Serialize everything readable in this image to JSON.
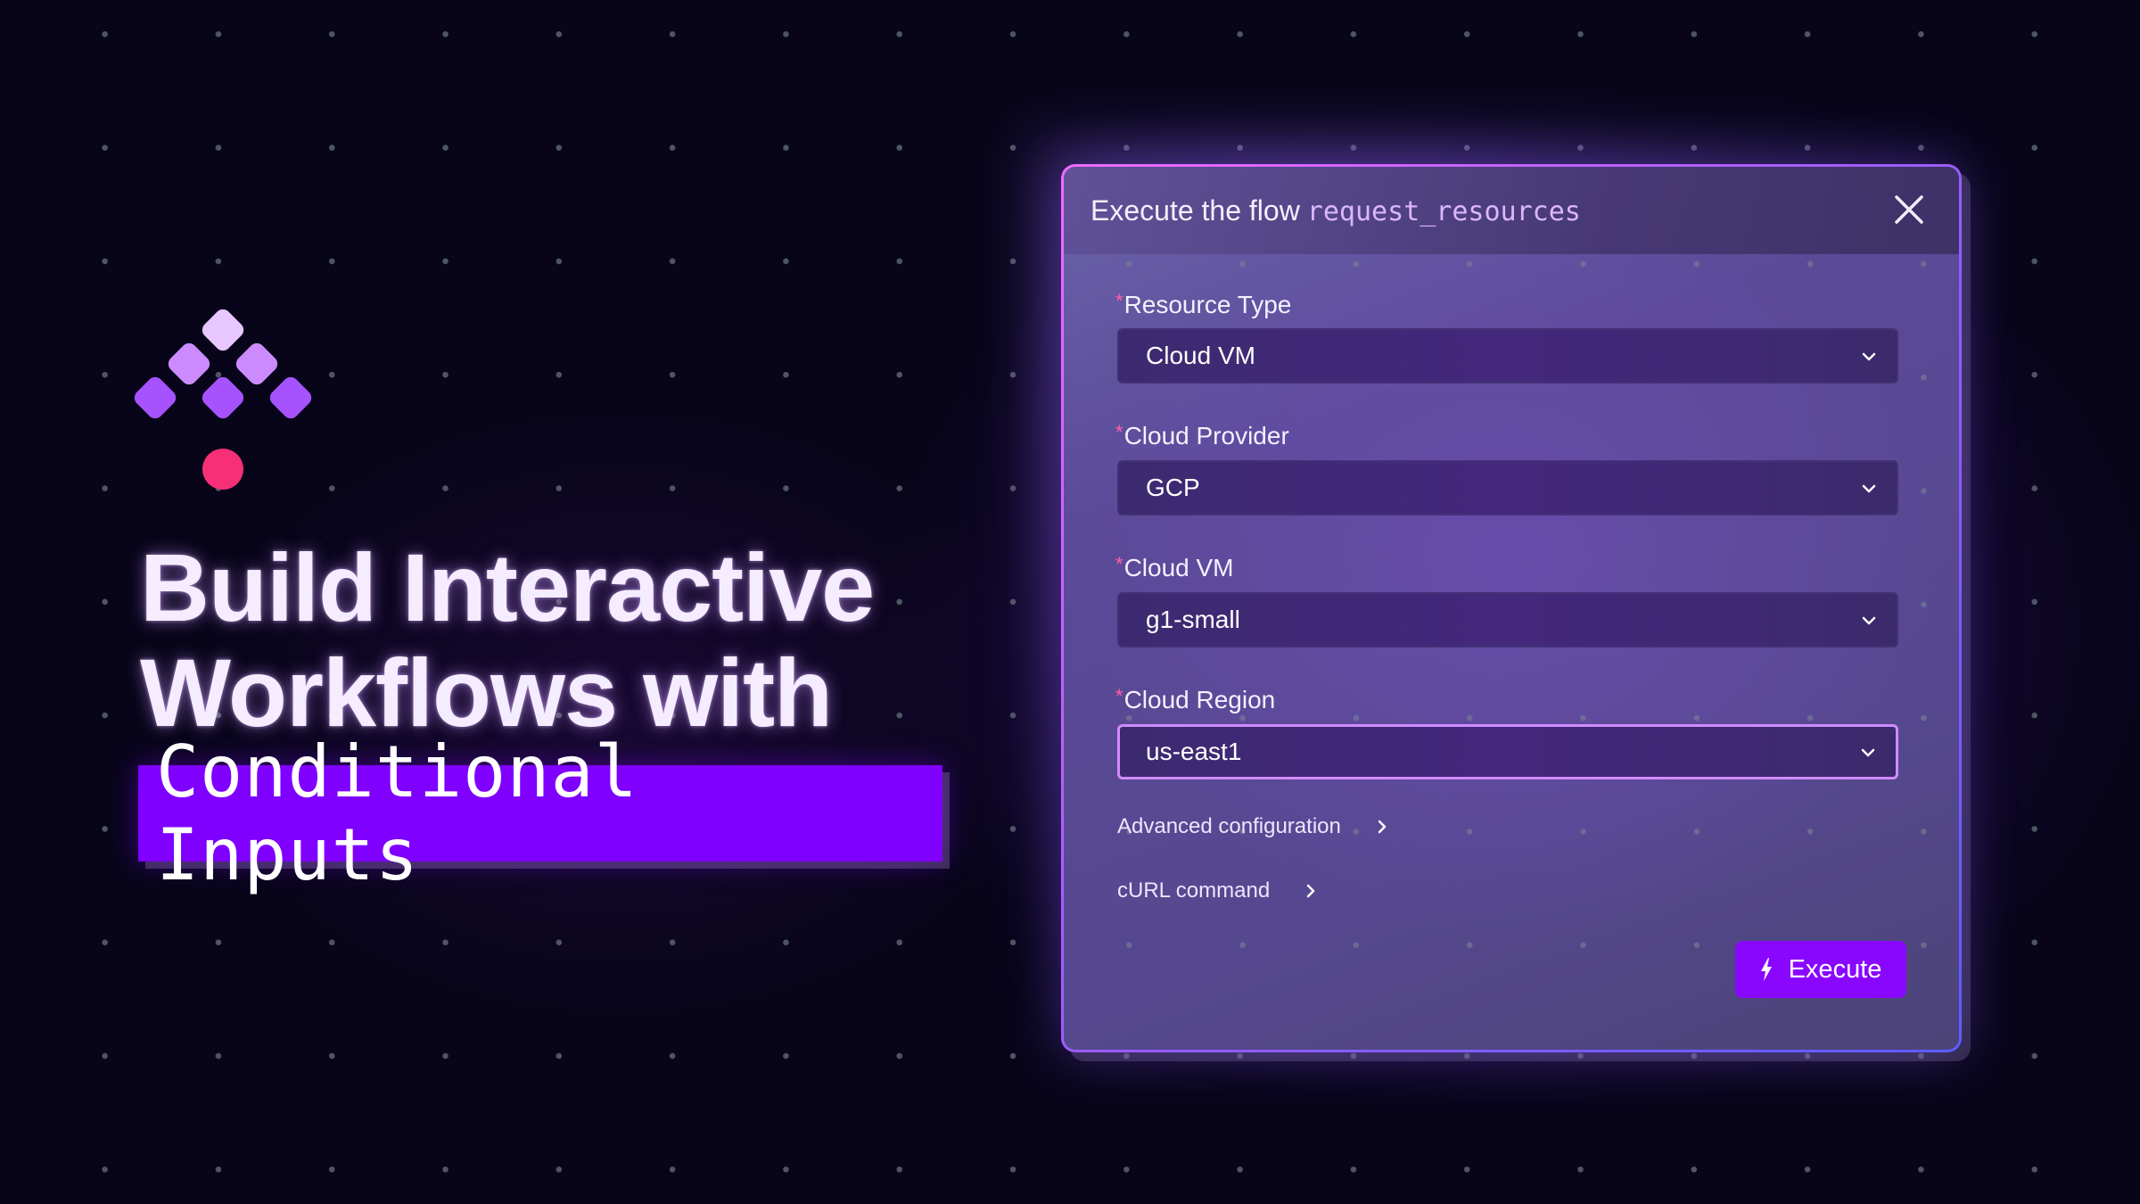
{
  "headline": {
    "line1": "Build Interactive",
    "line2": "Workflows with",
    "highlight": "Conditional Inputs"
  },
  "logo": {
    "name": "logo-icon",
    "colors": {
      "top": "#e8c6ff",
      "middle": "#cb8bff",
      "bottom": "#a652ff",
      "dot": "#f72f76"
    }
  },
  "modal": {
    "title_prefix": "Execute the flow",
    "flow_id": "request_resources",
    "close_icon": "close-icon",
    "fields": [
      {
        "label": "Resource Type",
        "required": true,
        "required_mark": "*",
        "value": "Cloud VM"
      },
      {
        "label": "Cloud Provider",
        "required": true,
        "required_mark": "*",
        "value": "GCP"
      },
      {
        "label": "Cloud VM",
        "required": true,
        "required_mark": "*",
        "value": "g1-small"
      },
      {
        "label": "Cloud Region",
        "required": true,
        "required_mark": "*",
        "value": "us-east1",
        "focused": true
      }
    ],
    "sections": [
      {
        "label": "Advanced configuration",
        "icon": "chevron-right-icon"
      },
      {
        "label": "cURL command",
        "icon": "chevron-right-icon"
      }
    ],
    "execute_button": {
      "label": "Execute",
      "icon": "lightning-icon",
      "color": "#8a07ff"
    }
  },
  "colors": {
    "background": "#08051a",
    "accent": "#7f00ff",
    "required": "#ff5fa8",
    "focus_border": "#d18bff"
  }
}
